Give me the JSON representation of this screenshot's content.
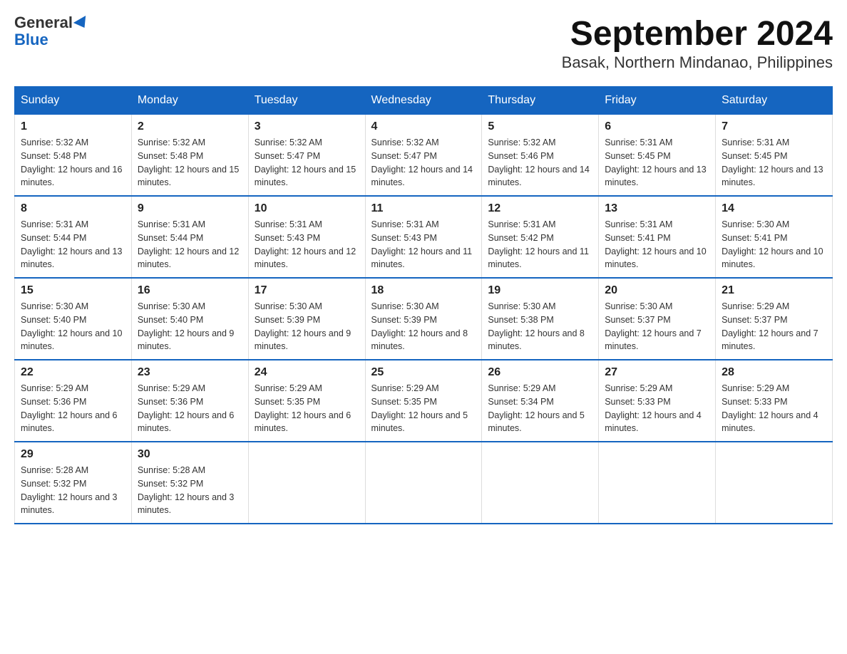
{
  "header": {
    "logo_general": "General",
    "logo_blue": "Blue",
    "title": "September 2024",
    "subtitle": "Basak, Northern Mindanao, Philippines"
  },
  "calendar": {
    "days_of_week": [
      "Sunday",
      "Monday",
      "Tuesday",
      "Wednesday",
      "Thursday",
      "Friday",
      "Saturday"
    ],
    "weeks": [
      [
        {
          "day": "1",
          "sunrise": "5:32 AM",
          "sunset": "5:48 PM",
          "daylight": "12 hours and 16 minutes."
        },
        {
          "day": "2",
          "sunrise": "5:32 AM",
          "sunset": "5:48 PM",
          "daylight": "12 hours and 15 minutes."
        },
        {
          "day": "3",
          "sunrise": "5:32 AM",
          "sunset": "5:47 PM",
          "daylight": "12 hours and 15 minutes."
        },
        {
          "day": "4",
          "sunrise": "5:32 AM",
          "sunset": "5:47 PM",
          "daylight": "12 hours and 14 minutes."
        },
        {
          "day": "5",
          "sunrise": "5:32 AM",
          "sunset": "5:46 PM",
          "daylight": "12 hours and 14 minutes."
        },
        {
          "day": "6",
          "sunrise": "5:31 AM",
          "sunset": "5:45 PM",
          "daylight": "12 hours and 13 minutes."
        },
        {
          "day": "7",
          "sunrise": "5:31 AM",
          "sunset": "5:45 PM",
          "daylight": "12 hours and 13 minutes."
        }
      ],
      [
        {
          "day": "8",
          "sunrise": "5:31 AM",
          "sunset": "5:44 PM",
          "daylight": "12 hours and 13 minutes."
        },
        {
          "day": "9",
          "sunrise": "5:31 AM",
          "sunset": "5:44 PM",
          "daylight": "12 hours and 12 minutes."
        },
        {
          "day": "10",
          "sunrise": "5:31 AM",
          "sunset": "5:43 PM",
          "daylight": "12 hours and 12 minutes."
        },
        {
          "day": "11",
          "sunrise": "5:31 AM",
          "sunset": "5:43 PM",
          "daylight": "12 hours and 11 minutes."
        },
        {
          "day": "12",
          "sunrise": "5:31 AM",
          "sunset": "5:42 PM",
          "daylight": "12 hours and 11 minutes."
        },
        {
          "day": "13",
          "sunrise": "5:31 AM",
          "sunset": "5:41 PM",
          "daylight": "12 hours and 10 minutes."
        },
        {
          "day": "14",
          "sunrise": "5:30 AM",
          "sunset": "5:41 PM",
          "daylight": "12 hours and 10 minutes."
        }
      ],
      [
        {
          "day": "15",
          "sunrise": "5:30 AM",
          "sunset": "5:40 PM",
          "daylight": "12 hours and 10 minutes."
        },
        {
          "day": "16",
          "sunrise": "5:30 AM",
          "sunset": "5:40 PM",
          "daylight": "12 hours and 9 minutes."
        },
        {
          "day": "17",
          "sunrise": "5:30 AM",
          "sunset": "5:39 PM",
          "daylight": "12 hours and 9 minutes."
        },
        {
          "day": "18",
          "sunrise": "5:30 AM",
          "sunset": "5:39 PM",
          "daylight": "12 hours and 8 minutes."
        },
        {
          "day": "19",
          "sunrise": "5:30 AM",
          "sunset": "5:38 PM",
          "daylight": "12 hours and 8 minutes."
        },
        {
          "day": "20",
          "sunrise": "5:30 AM",
          "sunset": "5:37 PM",
          "daylight": "12 hours and 7 minutes."
        },
        {
          "day": "21",
          "sunrise": "5:29 AM",
          "sunset": "5:37 PM",
          "daylight": "12 hours and 7 minutes."
        }
      ],
      [
        {
          "day": "22",
          "sunrise": "5:29 AM",
          "sunset": "5:36 PM",
          "daylight": "12 hours and 6 minutes."
        },
        {
          "day": "23",
          "sunrise": "5:29 AM",
          "sunset": "5:36 PM",
          "daylight": "12 hours and 6 minutes."
        },
        {
          "day": "24",
          "sunrise": "5:29 AM",
          "sunset": "5:35 PM",
          "daylight": "12 hours and 6 minutes."
        },
        {
          "day": "25",
          "sunrise": "5:29 AM",
          "sunset": "5:35 PM",
          "daylight": "12 hours and 5 minutes."
        },
        {
          "day": "26",
          "sunrise": "5:29 AM",
          "sunset": "5:34 PM",
          "daylight": "12 hours and 5 minutes."
        },
        {
          "day": "27",
          "sunrise": "5:29 AM",
          "sunset": "5:33 PM",
          "daylight": "12 hours and 4 minutes."
        },
        {
          "day": "28",
          "sunrise": "5:29 AM",
          "sunset": "5:33 PM",
          "daylight": "12 hours and 4 minutes."
        }
      ],
      [
        {
          "day": "29",
          "sunrise": "5:28 AM",
          "sunset": "5:32 PM",
          "daylight": "12 hours and 3 minutes."
        },
        {
          "day": "30",
          "sunrise": "5:28 AM",
          "sunset": "5:32 PM",
          "daylight": "12 hours and 3 minutes."
        },
        null,
        null,
        null,
        null,
        null
      ]
    ]
  }
}
